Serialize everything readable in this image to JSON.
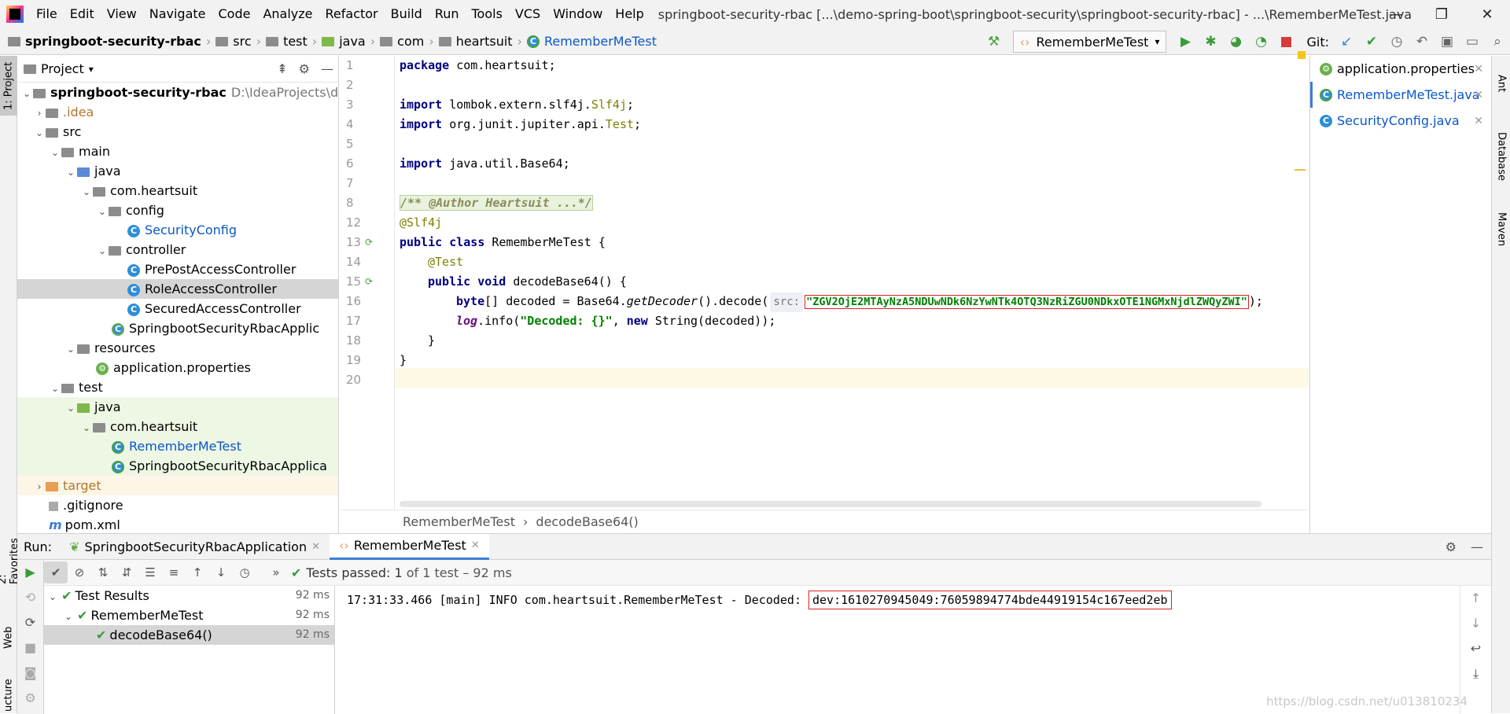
{
  "titlebar": {
    "menu": [
      "File",
      "Edit",
      "View",
      "Navigate",
      "Code",
      "Analyze",
      "Refactor",
      "Build",
      "Run",
      "Tools",
      "VCS",
      "Window",
      "Help"
    ],
    "title": "springboot-security-rbac [...\\demo-spring-boot\\springboot-security\\springboot-security-rbac] - ...\\RememberMeTest.java"
  },
  "navbar": {
    "crumbs": [
      "springboot-security-rbac",
      "src",
      "test",
      "java",
      "com",
      "heartsuit",
      "RememberMeTest"
    ],
    "run_config": "RememberMeTest",
    "git_label": "Git:"
  },
  "left_strip": {
    "project": "1: Project",
    "favorites": "2: Favorites",
    "web": "Web",
    "structure": "ucture"
  },
  "right_strip": {
    "ant": "Ant",
    "database": "Database",
    "maven": "Maven"
  },
  "project": {
    "header": "Project",
    "root_name": "springboot-security-rbac",
    "root_path": "D:\\IdeaProjects\\demo",
    "items": [
      "springboot-security-rbac",
      ".idea",
      "src",
      "main",
      "java",
      "com.heartsuit",
      "config",
      "SecurityConfig",
      "controller",
      "PrePostAccessController",
      "RoleAccessController",
      "SecuredAccessController",
      "SpringbootSecurityRbacApplic",
      "resources",
      "application.properties",
      "test",
      "java",
      "com.heartsuit",
      "RememberMeTest",
      "SpringbootSecurityRbacApplica",
      "target",
      ".gitignore",
      "pom.xml"
    ]
  },
  "editor": {
    "line_numbers": [
      "1",
      "2",
      "3",
      "4",
      "5",
      "6",
      "7",
      "8",
      "12",
      "13",
      "14",
      "15",
      "16",
      "17",
      "18",
      "19",
      "20"
    ],
    "code": {
      "l1_kw": "package",
      "l1_rest": " com.heartsuit;",
      "l3_kw": "import",
      "l3_rest": " lombok.extern.slf4j.",
      "l3_ann": "Slf4j",
      "l3_end": ";",
      "l4_kw": "import",
      "l4_rest": " org.junit.jupiter.api.",
      "l4_ann": "Test",
      "l4_end": ";",
      "l6_kw": "import",
      "l6_rest": " java.util.Base64;",
      "l8": "/** @Author Heartsuit ...*/",
      "l12": "@Slf4j",
      "l13_kw": "public class",
      "l13_rest": " RememberMeTest {",
      "l14": "@Test",
      "l15_kw": "public void",
      "l15_rest": " decodeBase64() {",
      "l16_kw": "byte",
      "l16_a": "[] decoded = Base64.",
      "l16_b": "getDecoder",
      "l16_c": "().decode(",
      "l16_hint": "src:",
      "l16_str": "\"ZGV2OjE2MTAyNzA5NDUwNDk6NzYwNTk4OTQ3NzRiZGU0NDkxOTE1NGMxNjdlZWQyZWI\"",
      "l16_end": ");",
      "l17_log": "log",
      "l17_a": ".info(",
      "l17_str": "\"Decoded: {}\"",
      "l17_b": ", ",
      "l17_kw": "new",
      "l17_c": " String(decoded));",
      "l18": "}",
      "l19": "}"
    },
    "breadcrumb": [
      "RememberMeTest",
      "decodeBase64()"
    ]
  },
  "recent_files": [
    {
      "name": "application.properties"
    },
    {
      "name": "RememberMeTest.java"
    },
    {
      "name": "SecurityConfig.java"
    }
  ],
  "run": {
    "label": "Run:",
    "tabs": [
      "SpringbootSecurityRbacApplication",
      "RememberMeTest"
    ],
    "status_prefix": "Tests passed:",
    "status_count": "1",
    "status_suffix": "of 1 test – 92 ms",
    "tree": [
      {
        "name": "Test Results",
        "time": "92 ms"
      },
      {
        "name": "RememberMeTest",
        "time": "92 ms"
      },
      {
        "name": "decodeBase64()",
        "time": "92 ms"
      }
    ],
    "console_prefix": "17:31:33.466 [main] INFO com.heartsuit.RememberMeTest - Decoded: ",
    "console_value": "dev:1610270945049:76059894774bde44919154c167eed2eb"
  },
  "watermark": "https://blog.csdn.net/u013810234"
}
